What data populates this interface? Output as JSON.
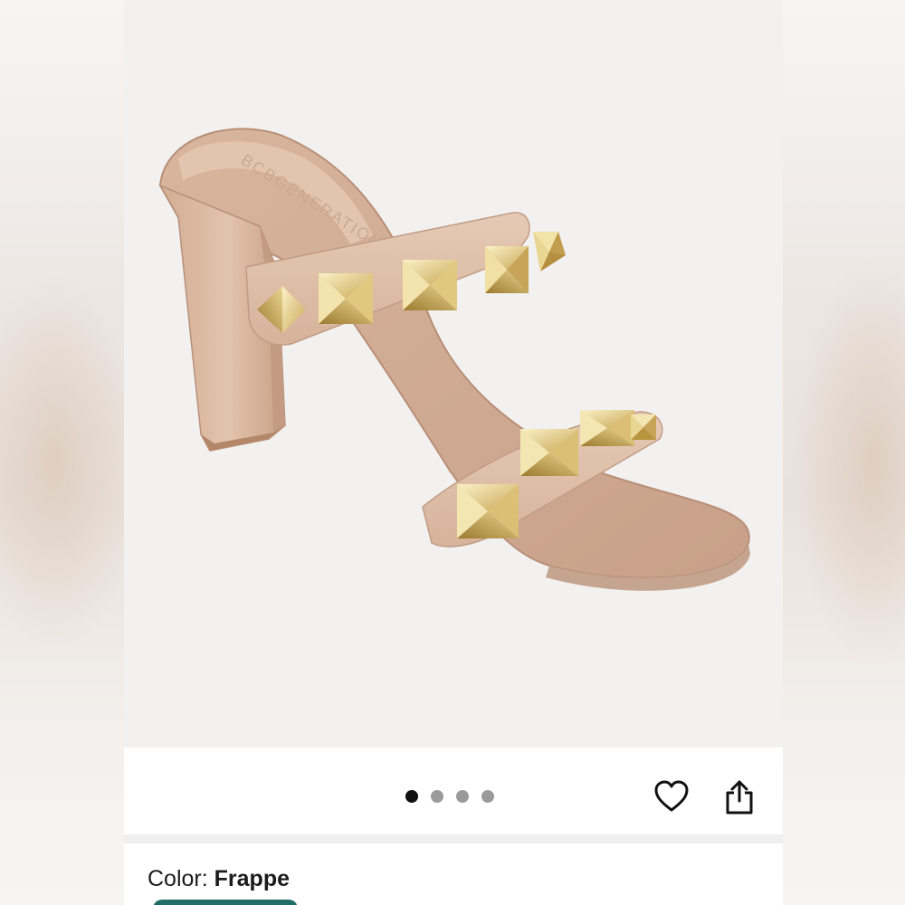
{
  "gallery": {
    "image_alt": "Nude studded block-heel double strap sandal",
    "brand_imprint": "BCBGENERATION",
    "page_count": 4,
    "active_index": 0
  },
  "actions": {
    "favorite_icon": "heart-icon",
    "share_icon": "share-icon"
  },
  "product": {
    "color_label": "Color:",
    "color_value": "Frappe"
  },
  "colors": {
    "shoe_nude": "#d9b9a2",
    "stud_gold": "#d4b86a",
    "active_dot": "#111111",
    "inactive_dot": "#9a9a9a",
    "swatch_teal": "#1f6e68"
  }
}
